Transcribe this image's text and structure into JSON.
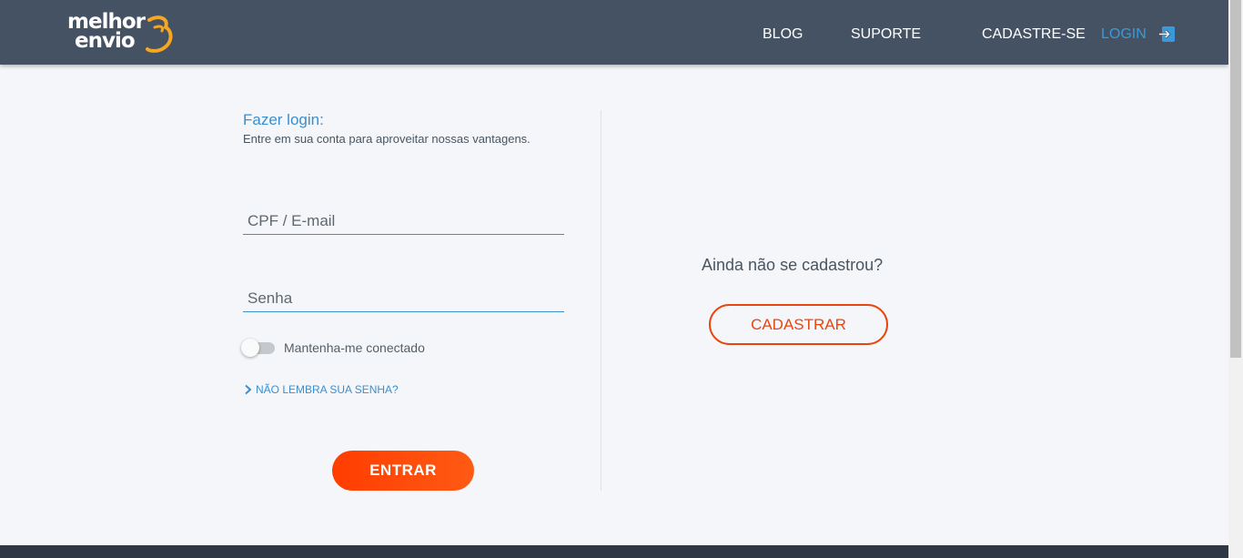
{
  "brand": {
    "logo_line1": "melhor",
    "logo_line2": "envio",
    "logo_color": "#ffffff",
    "accent_color": "#f5a623"
  },
  "nav": {
    "blog": "BLOG",
    "support": "SUPORTE",
    "signup": "CADASTRE-SE",
    "login": "LOGIN",
    "login_icon": "sign-in-icon"
  },
  "login": {
    "title": "Fazer login:",
    "subtitle": "Entre em sua conta para aproveitar nossas vantagens.",
    "cpf_placeholder": "CPF / E-mail",
    "cpf_value": "",
    "password_placeholder": "Senha",
    "password_value": "",
    "remember_label": "Mantenha-me conectado",
    "remember_checked": false,
    "forgot_link": "NÃO LEMBRA SUA SENHA?",
    "submit_label": "ENTRAR"
  },
  "register": {
    "question": "Ainda não se cadastrou?",
    "button_label": "CADASTRAR"
  },
  "colors": {
    "header_bg": "#455263",
    "primary_blue": "#3a8fd0",
    "cta_orange": "#ff4500",
    "page_bg": "#f4f6f9"
  }
}
